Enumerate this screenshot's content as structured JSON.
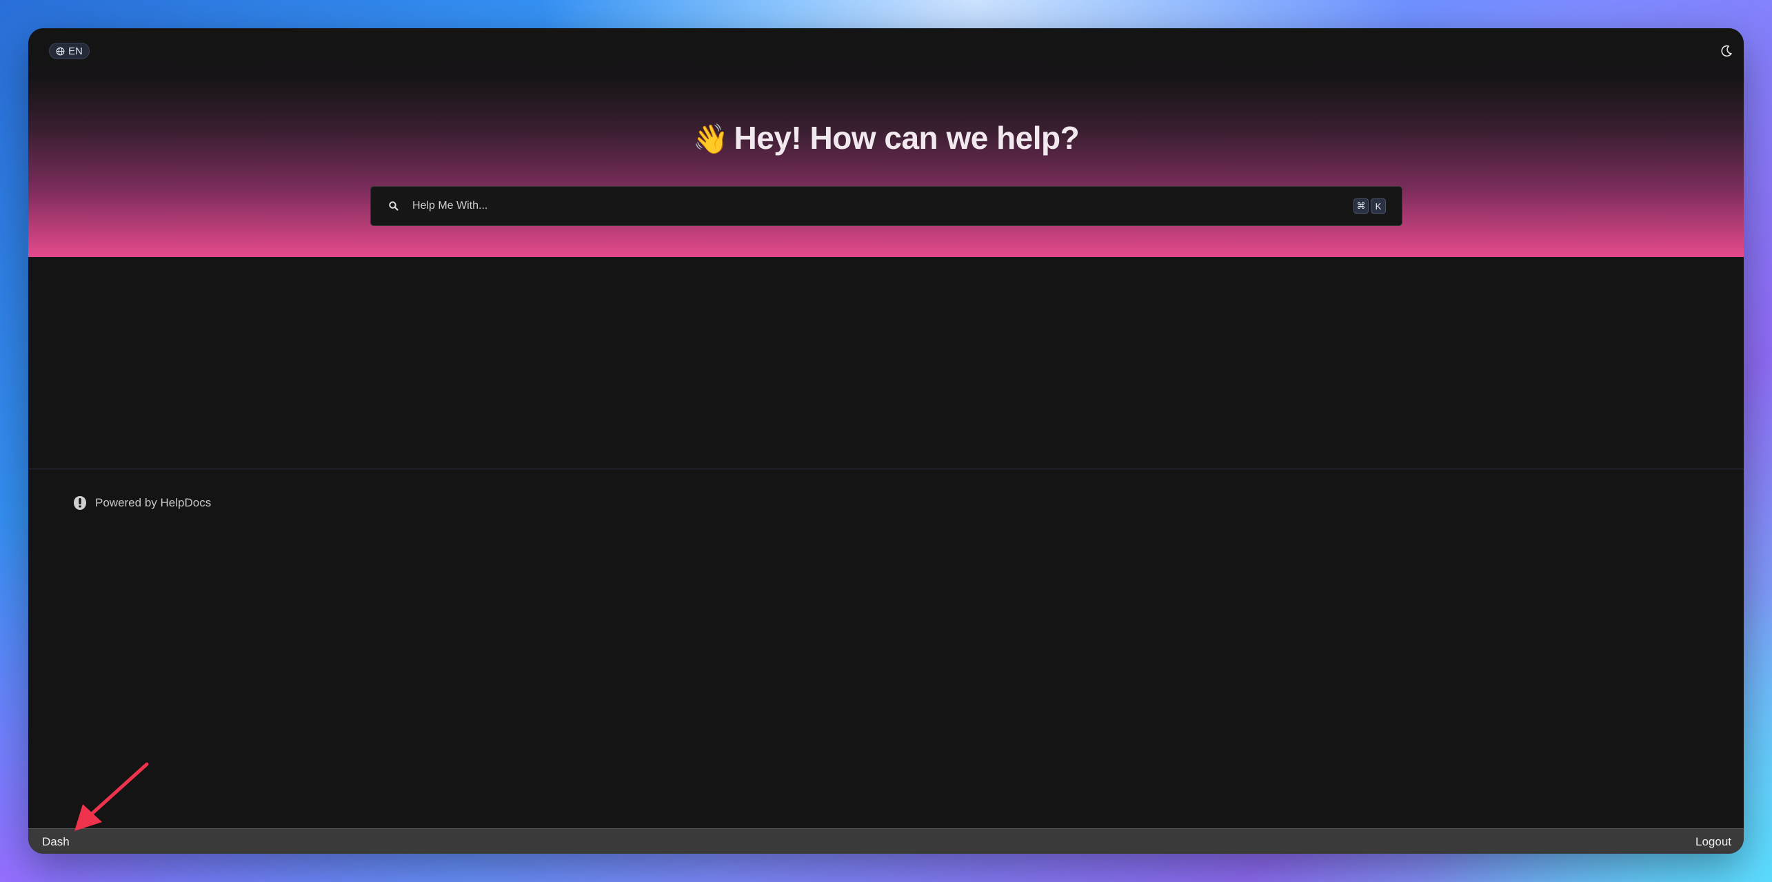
{
  "header": {
    "language_label": "EN",
    "language_icon": "globe-icon",
    "theme_toggle_icon": "moon-icon"
  },
  "hero": {
    "wave_emoji": "👋",
    "title": "Hey! How can we help?"
  },
  "search": {
    "placeholder": "Help Me With...",
    "shortcut_keys": [
      "⌘",
      "K"
    ]
  },
  "footer": {
    "powered_by": "Powered by HelpDocs"
  },
  "bottom_bar": {
    "left_label": "Dash",
    "right_label": "Logout"
  },
  "colors": {
    "background": "#141414",
    "hero_gradient_end": "#e64a8c",
    "annotation_arrow": "#f0334d"
  }
}
